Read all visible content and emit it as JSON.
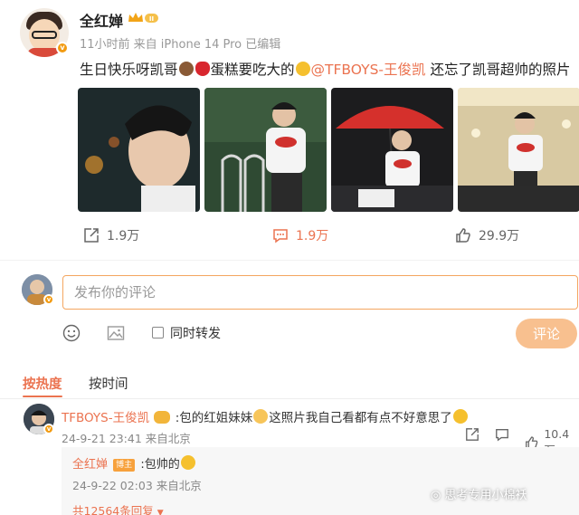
{
  "post": {
    "username": "全红婵",
    "meta": "11小时前 来自 iPhone 14 Pro 已编辑",
    "text_before": "生日快乐呀凯哥",
    "text_middle": "蛋糕要吃大的",
    "mention": "@TFBOYS-王俊凯",
    "text_after": " 还忘了凯哥超帅的照片",
    "emojis": [
      "cake-emoji",
      "rose-emoji",
      "grin-emoji"
    ]
  },
  "actions": {
    "share_count": "1.9万",
    "comment_count": "1.9万",
    "like_count": "29.9万"
  },
  "composer": {
    "placeholder": "发布你的评论",
    "repost_label": "同时转发",
    "submit_label": "评论"
  },
  "sort": {
    "hot": "按热度",
    "time": "按时间"
  },
  "comment": {
    "username": "TFBOYS-王俊凯",
    "text_a": ":包的红姐妹妹",
    "text_b": "这照片我自己看都有点不好意思了",
    "meta": "24-9-21 23:41 来自北京",
    "like_count": "10.4万"
  },
  "reply": {
    "username": "全红婵",
    "badge": "博主",
    "text": ":包帅的",
    "meta": "24-9-22 02:03 来自北京",
    "more": "共12564条回复"
  },
  "watermark": "思考专用小棉袄",
  "colors": {
    "accent": "#eb7350",
    "vip_orange": "#f29b12",
    "input_border": "#f4a660",
    "button_bg": "#f8c08f"
  }
}
